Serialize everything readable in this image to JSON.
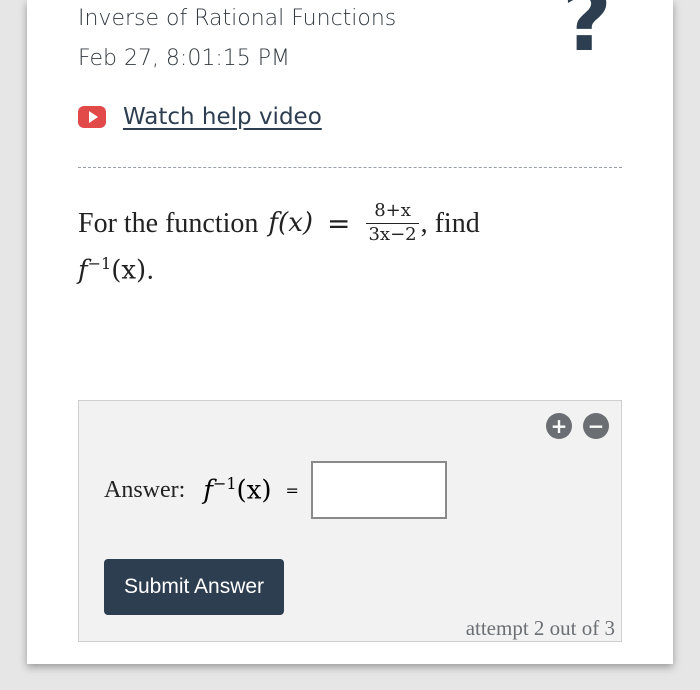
{
  "header": {
    "title": "Inverse of Rational Functions",
    "timestamp": "Feb 27, 8:01:15 PM",
    "help_mark": "?"
  },
  "help_video": {
    "icon": "play-video-icon",
    "label": "Watch help video",
    "icon_color": "#e24a4a"
  },
  "question": {
    "prefix": "For the function",
    "func_lhs": "f(x)",
    "equals": "=",
    "numerator": "8+x",
    "denominator": "3x−2",
    "suffix": ", find",
    "target_base": "f",
    "target_exp": "−1",
    "target_arg": "(x)."
  },
  "answer": {
    "label": "Answer:",
    "lhs_base": "f",
    "lhs_exp": "−1",
    "lhs_arg": "(x)",
    "equals": "=",
    "input_value": "",
    "zoom_in_symbol": "+",
    "zoom_out_symbol": "−",
    "submit_label": "Submit Answer",
    "attempt_text": "attempt 2 out of 3"
  },
  "colors": {
    "navy": "#2d3e50",
    "background": "#e6e6e6",
    "answer_panel": "#f2f2f2"
  }
}
